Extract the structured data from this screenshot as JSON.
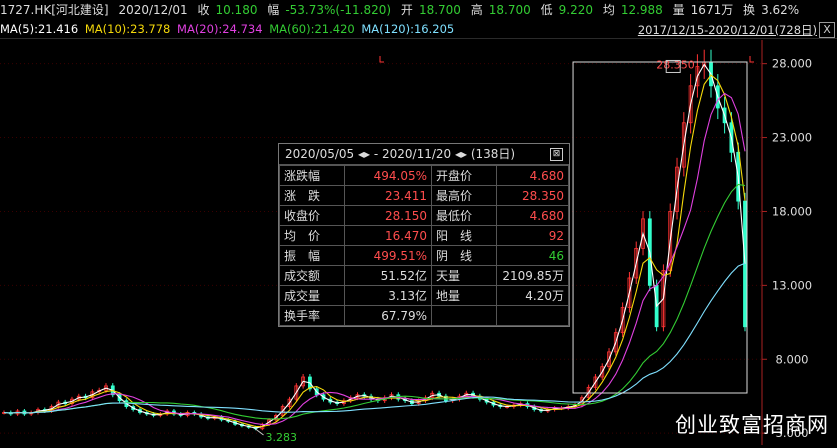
{
  "header": {
    "code": "1727.HK[河北建设]",
    "date": "2020/12/01",
    "close_label": "收",
    "close_value": "10.180",
    "amp_label": "幅",
    "amp_value": "-53.73%(-11.820)",
    "open_label": "开",
    "open_value": "18.700",
    "high_label": "高",
    "high_value": "18.700",
    "low_label": "低",
    "low_value": "9.220",
    "avg_label": "均",
    "avg_value": "12.988",
    "vol_label": "量",
    "vol_value": "1671万",
    "turnover_label": "换",
    "turnover_value": "3.62%"
  },
  "ma": [
    {
      "label": "MA(5):21.416",
      "color": "#ffffff"
    },
    {
      "label": "MA(10):23.778",
      "color": "#f5d90a"
    },
    {
      "label": "MA(20):24.734",
      "color": "#e040e0"
    },
    {
      "label": "MA(60):21.420",
      "color": "#33cc33"
    },
    {
      "label": "MA(120):16.205",
      "color": "#7fe0ff"
    }
  ],
  "range_label": "2017/12/15-2020/12/01(728日)",
  "close_button": "X",
  "stats": {
    "head": "2020/05/05 ◂▸ - 2020/11/20 ◂▸  (138日)",
    "close_icon": "⊠",
    "rows": [
      [
        "涨跌幅",
        "494.05%",
        "开盘价",
        "4.680"
      ],
      [
        "涨　跌",
        "23.411",
        "最高价",
        "28.350"
      ],
      [
        "收盘价",
        "28.150",
        "最低价",
        "4.680"
      ],
      [
        "均　价",
        "16.470",
        "阳　线",
        "92"
      ],
      [
        "振　幅",
        "499.51%",
        "阴　线",
        "46"
      ],
      [
        "成交额",
        "51.52亿",
        "天量",
        "2109.85万"
      ],
      [
        "成交量",
        "3.13亿",
        "地量",
        "4.20万"
      ],
      [
        "换手率",
        "67.79%",
        "",
        ""
      ]
    ],
    "colors": [
      [
        "red",
        "red"
      ],
      [
        "red",
        "red"
      ],
      [
        "red",
        "red"
      ],
      [
        "red",
        "red"
      ],
      [
        "red",
        "grn"
      ],
      [
        "lbl",
        "lbl"
      ],
      [
        "lbl",
        "lbl"
      ],
      [
        "lbl",
        "lbl"
      ]
    ]
  },
  "chart_data": {
    "type": "line",
    "y_ticks": [
      "28.000",
      "23.000",
      "18.000",
      "13.000",
      "8.000",
      "3.000"
    ],
    "y_tick_values": [
      28,
      23,
      18,
      13,
      8,
      3
    ],
    "ylim": [
      2.2,
      29.6
    ],
    "annotations": {
      "low_marker": "3.283",
      "high_marker": "28.350"
    },
    "series": [
      {
        "name": "Close",
        "color": "#ff3333",
        "values": [
          4.4,
          4.3,
          4.5,
          4.3,
          4.4,
          4.6,
          4.5,
          4.8,
          5.1,
          5.0,
          5.3,
          5.5,
          5.4,
          5.8,
          5.9,
          6.2,
          5.6,
          5.2,
          4.8,
          4.6,
          4.4,
          4.3,
          4.2,
          4.3,
          4.5,
          4.3,
          4.2,
          4.4,
          4.3,
          4.1,
          4.0,
          4.1,
          3.9,
          3.8,
          3.6,
          3.5,
          3.4,
          3.3,
          3.6,
          3.9,
          4.2,
          4.8,
          5.3,
          6.2,
          6.8,
          6.0,
          5.6,
          5.3,
          5.1,
          5.0,
          5.2,
          5.4,
          5.6,
          5.5,
          5.3,
          5.2,
          5.4,
          5.6,
          5.3,
          5.2,
          5.0,
          5.2,
          5.4,
          5.7,
          5.5,
          5.2,
          5.3,
          5.5,
          5.7,
          5.5,
          5.3,
          5.1,
          4.9,
          4.8,
          4.8,
          4.9,
          5.0,
          4.8,
          4.6,
          4.5,
          4.6,
          4.7,
          4.7,
          4.8,
          4.9,
          5.4,
          6.1,
          6.8,
          7.5,
          8.5,
          9.8,
          11.5,
          13.5,
          15.5,
          17.5,
          13.0,
          10.2,
          14.0,
          18.0,
          21.0,
          24.0,
          26.5,
          27.8,
          28.1,
          26.5,
          25.0,
          24.0,
          22.0,
          18.7,
          10.2
        ],
        "low": 3.283,
        "high": 28.35
      },
      {
        "name": "MA(5)",
        "color": "#ffffff",
        "values": []
      },
      {
        "name": "MA(10)",
        "color": "#f5d90a",
        "values": []
      },
      {
        "name": "MA(20)",
        "color": "#e040e0",
        "values": []
      },
      {
        "name": "MA(60)",
        "color": "#33cc33",
        "values": []
      },
      {
        "name": "MA(120)",
        "color": "#7fe0ff",
        "values": []
      }
    ]
  },
  "watermark": "创业致富招商网"
}
